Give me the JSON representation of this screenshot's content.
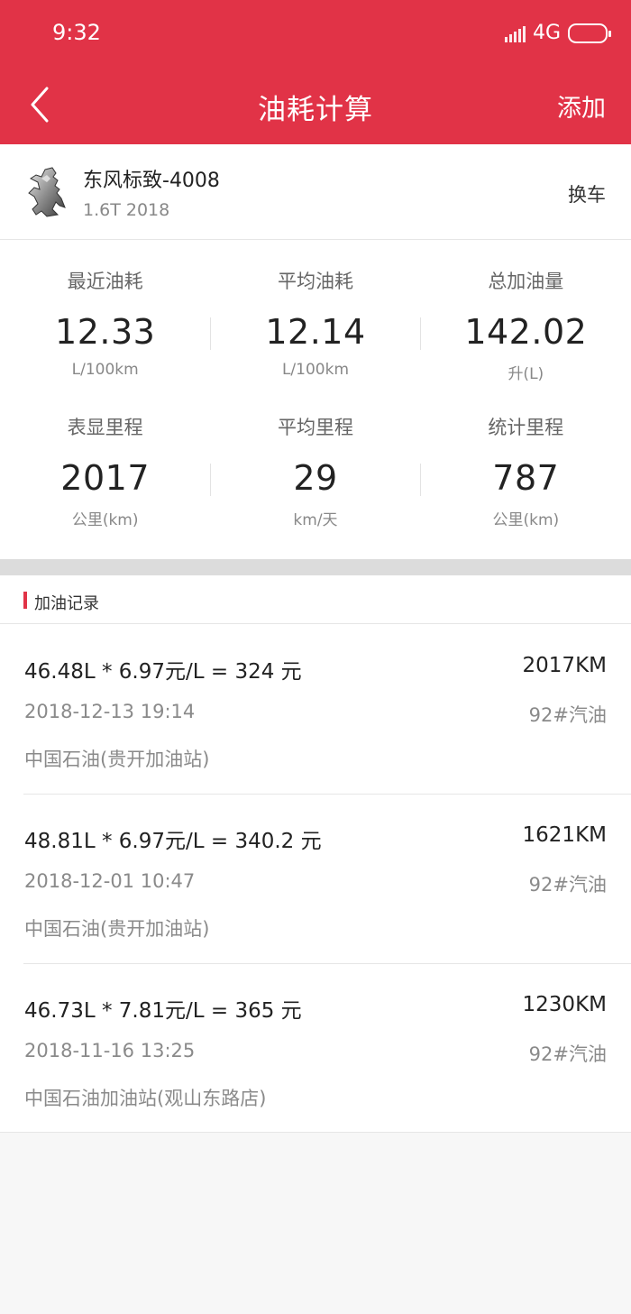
{
  "status_bar": {
    "time": "9:32",
    "network": "4G"
  },
  "nav": {
    "title": "油耗计算",
    "add_label": "添加",
    "back_icon": "chevron-left-icon"
  },
  "car": {
    "name": "东风标致-4008",
    "spec": "1.6T  2018",
    "change_label": "换车",
    "logo_icon": "peugeot-lion-logo"
  },
  "stats": [
    [
      {
        "label": "最近油耗",
        "value": "12.33",
        "unit": "L/100km"
      },
      {
        "label": "平均油耗",
        "value": "12.14",
        "unit": "L/100km"
      },
      {
        "label": "总加油量",
        "value": "142.02",
        "unit": "升(L)"
      }
    ],
    [
      {
        "label": "表显里程",
        "value": "2017",
        "unit": "公里(km)"
      },
      {
        "label": "平均里程",
        "value": "29",
        "unit": "km/天"
      },
      {
        "label": "统计里程",
        "value": "787",
        "unit": "公里(km)"
      }
    ]
  ],
  "records_title": "加油记录",
  "records": [
    {
      "formula": "46.48L * 6.97元/L = 324 元",
      "km": "2017KM",
      "date": "2018-12-13 19:14",
      "fuel": "92#汽油",
      "station": "中国石油(贵开加油站)"
    },
    {
      "formula": "48.81L * 6.97元/L = 340.2 元",
      "km": "1621KM",
      "date": "2018-12-01 10:47",
      "fuel": "92#汽油",
      "station": "中国石油(贵开加油站)"
    },
    {
      "formula": "46.73L * 7.81元/L = 365 元",
      "km": "1230KM",
      "date": "2018-11-16 13:25",
      "fuel": "92#汽油",
      "station": "中国石油加油站(观山东路店)"
    }
  ],
  "colors": {
    "accent": "#e13347",
    "background": "#f7f7f7"
  }
}
